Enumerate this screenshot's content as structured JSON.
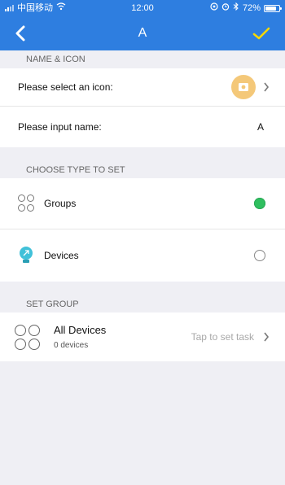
{
  "status_bar": {
    "carrier": "中国移动",
    "time": "12:00",
    "battery": "72%"
  },
  "nav": {
    "title": "A"
  },
  "sections": {
    "name_icon": {
      "header": "NAME & ICON",
      "select_icon_label": "Please select an icon:",
      "input_name_label": "Please input name:",
      "name_value": "A"
    },
    "type": {
      "header": "CHOOSE TYPE TO SET",
      "groups_label": "Groups",
      "devices_label": "Devices",
      "selected": "Groups"
    },
    "set_group": {
      "header": "SET GROUP",
      "group_name": "All Devices",
      "group_count": "0 devices",
      "action": "Tap to set task"
    }
  },
  "colors": {
    "accent": "#2e7ee0",
    "selected_radio": "#2fbf5f",
    "icon_avatar": "#f4c879",
    "device_icon": "#41c1d9",
    "check": "#f6d800"
  }
}
